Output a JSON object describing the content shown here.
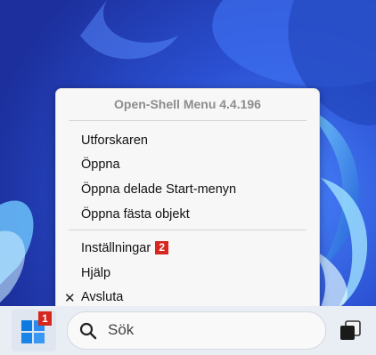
{
  "menu": {
    "title": "Open-Shell Menu 4.4.196",
    "items": [
      {
        "label": "Utforskaren"
      },
      {
        "label": "Öppna"
      },
      {
        "label": "Öppna delade Start-menyn"
      },
      {
        "label": "Öppna fästa objekt"
      },
      {
        "label": "Inställningar",
        "badge": "2"
      },
      {
        "label": "Hjälp"
      },
      {
        "label": "Avsluta",
        "check": "✕"
      }
    ]
  },
  "taskbar": {
    "start_badge": "1",
    "search_placeholder": "Sök"
  },
  "icons": {
    "start": "windows-logo-icon",
    "search": "magnifier-icon",
    "task_view": "task-view-icon"
  },
  "colors": {
    "badge": "#d7261e",
    "windows_logo": "#0078d4"
  }
}
